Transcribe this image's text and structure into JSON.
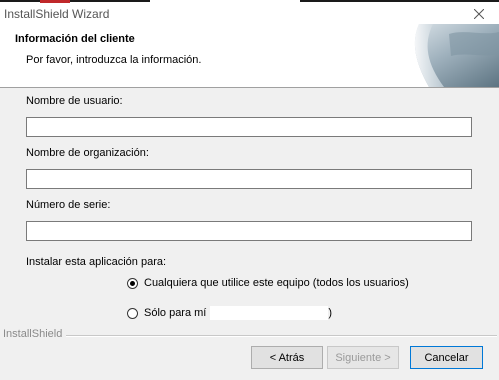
{
  "window": {
    "title": "InstallShield Wizard"
  },
  "header": {
    "title": "Información del cliente",
    "subtitle": "Por favor, introduzca la información."
  },
  "form": {
    "username_label": "Nombre de usuario:",
    "username_value": "",
    "organization_label": "Nombre de organización:",
    "organization_value": "",
    "serial_label": "Número de serie:",
    "serial_value": ""
  },
  "install_for": {
    "label": "Instalar esta aplicación para:",
    "options": [
      {
        "label": "Cualquiera que utilice este equipo (todos los usuarios)",
        "selected": true
      },
      {
        "label": "Sólo para mí",
        "suffix": ")",
        "selected": false
      }
    ]
  },
  "footer": {
    "brand": "InstallShield",
    "back_label": "< Atrás",
    "next_label": "Siguiente >",
    "cancel_label": "Cancelar"
  },
  "colors": {
    "dialog_bg": "#f0f0f0",
    "header_bg": "#ffffff",
    "primary_border": "#0078d7"
  }
}
